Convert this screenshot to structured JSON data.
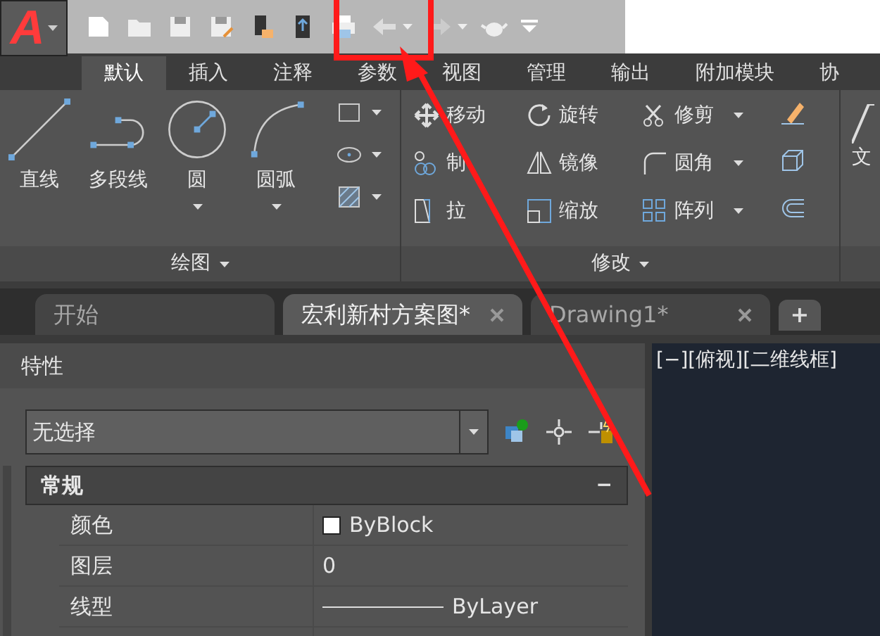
{
  "app_button": {
    "letter": "A"
  },
  "ribbon_tabs": [
    {
      "label": "默认",
      "selected": true
    },
    {
      "label": "插入",
      "selected": false
    },
    {
      "label": "注释",
      "selected": false
    },
    {
      "label": "参数",
      "selected": false
    },
    {
      "label": "视图",
      "selected": false
    },
    {
      "label": "管理",
      "selected": false
    },
    {
      "label": "输出",
      "selected": false
    },
    {
      "label": "附加模块",
      "selected": false
    },
    {
      "label": "协",
      "selected": false
    }
  ],
  "draw_panel": {
    "title": "绘图",
    "tools": [
      {
        "label": "直线",
        "kind": "line",
        "dropdown": false
      },
      {
        "label": "多段线",
        "kind": "polyline",
        "dropdown": false
      },
      {
        "label": "圆",
        "kind": "circle",
        "dropdown": true
      },
      {
        "label": "圆弧",
        "kind": "arc",
        "dropdown": true
      }
    ]
  },
  "modify_panel": {
    "title": "修改",
    "tools": [
      {
        "label": "移动",
        "kind": "move",
        "dropdown": false
      },
      {
        "label": "旋转",
        "kind": "rotate",
        "dropdown": false
      },
      {
        "label": "修剪",
        "kind": "trim",
        "dropdown": true
      },
      {
        "label": "制",
        "kind": "copy",
        "dropdown": false
      },
      {
        "label": "镜像",
        "kind": "mirror",
        "dropdown": false
      },
      {
        "label": "圆角",
        "kind": "fillet",
        "dropdown": true
      },
      {
        "label": "拉",
        "kind": "stretch",
        "dropdown": false
      },
      {
        "label": "缩放",
        "kind": "scale",
        "dropdown": false
      },
      {
        "label": "阵列",
        "kind": "array",
        "dropdown": true
      }
    ]
  },
  "annotation_panel": {
    "label": "文"
  },
  "file_tabs": [
    {
      "label": "开始",
      "selected": false,
      "closable": false
    },
    {
      "label": "宏利新村方案图*",
      "selected": true,
      "closable": true
    },
    {
      "label": "Drawing1*",
      "selected": false,
      "closable": true
    }
  ],
  "new_tab": "+",
  "properties": {
    "title": "特性",
    "selection": "无选择",
    "section": "常规",
    "toggle": "−",
    "rows": [
      {
        "name": "颜色",
        "value": "ByBlock",
        "kind": "color"
      },
      {
        "name": "图层",
        "value": "0",
        "kind": "text"
      },
      {
        "name": "线型",
        "value": "ByLayer",
        "kind": "linetype"
      }
    ]
  },
  "viewport": {
    "label": "[−][俯视][二维线框]"
  }
}
